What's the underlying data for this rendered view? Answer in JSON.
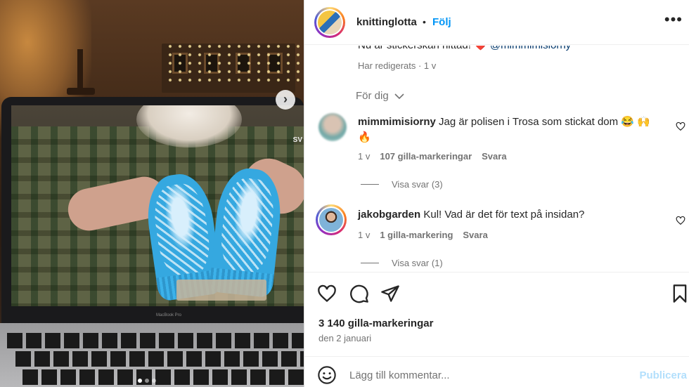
{
  "post": {
    "username": "knittinglotta",
    "bullet": "•",
    "follow_label": "Följ",
    "more_label": "•••"
  },
  "caption": {
    "text": "Nu är stickerskan hittad!",
    "heart": "❤️",
    "mention": "@mimmimisiorny",
    "edited": "Har redigerats · 1 v"
  },
  "for_you": "För dig",
  "comments": [
    {
      "username": "mimmimisiorny",
      "text_line1": "Jag är polisen i Trosa som stickat dom 😂 🙌",
      "text_line2": "🔥",
      "time": "1 v",
      "likes": "107 gilla-markeringar",
      "reply": "Svara",
      "view_replies": "Visa svar (3)"
    },
    {
      "username": "jakobgarden",
      "text_line1": "Kul! Vad är det för text på insidan?",
      "time": "1 v",
      "likes": "1 gilla-markering",
      "reply": "Svara",
      "view_replies": "Visa svar (1)"
    }
  ],
  "footer": {
    "likes_count": "3 140 gilla-markeringar",
    "date": "den 2 januari"
  },
  "add_comment": {
    "placeholder": "Lägg till kommentar...",
    "publish_label": "Publicera"
  },
  "photo": {
    "laptop_label": "MacBook Pro",
    "screen_overlay": "SV",
    "carousel_total": 3,
    "carousel_active": 1
  },
  "colors": {
    "accent": "#0095f6",
    "publish_disabled": "#b2dffc",
    "heart": "#e0245e",
    "mention": "#00376b",
    "mitten_blue": "#35a8e0"
  },
  "icons": {
    "like": "heart-icon",
    "comment": "comment-icon",
    "share": "paper-plane-icon",
    "save": "bookmark-icon",
    "emoji": "smiley-icon",
    "more": "ellipsis-icon",
    "chevron": "chevron-down-icon",
    "next": "chevron-right-icon"
  }
}
